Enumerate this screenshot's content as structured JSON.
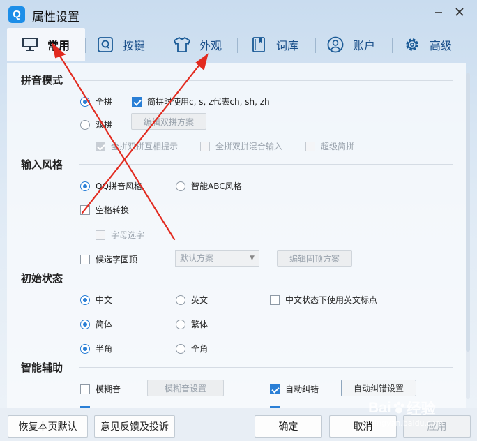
{
  "window": {
    "title": "属性设置",
    "logo_letter": "Q"
  },
  "tabs": [
    {
      "label": "常用",
      "icon": "monitor-icon",
      "active": true
    },
    {
      "label": "按键",
      "icon": "key-q-icon"
    },
    {
      "label": "外观",
      "icon": "tshirt-icon"
    },
    {
      "label": "词库",
      "icon": "book-icon"
    },
    {
      "label": "账户",
      "icon": "user-icon"
    },
    {
      "label": "高级",
      "icon": "gear-icon"
    }
  ],
  "sections": {
    "pinyin_mode": {
      "title": "拼音模式",
      "full_pinyin": "全拼",
      "simple_pinyin": "简拼时使用c, s, z代表ch, sh, zh",
      "double_pinyin": "双拼",
      "edit_double_scheme": "编辑双拼方案",
      "full_double_hint": "全拼双拼互相提示",
      "full_double_mix": "全拼双拼混合输入",
      "super_simple": "超级简拼"
    },
    "input_style": {
      "title": "输入风格",
      "qq_style": "QQ拼音风格",
      "abc_style": "智能ABC风格",
      "space_convert": "空格转换",
      "letter_select": "字母选字",
      "fixed_candidates": "候选字固顶",
      "default_scheme": "默认方案",
      "edit_fixed_scheme": "编辑固顶方案"
    },
    "initial_state": {
      "title": "初始状态",
      "chinese": "中文",
      "english": "英文",
      "en_punct": "中文状态下使用英文标点",
      "simplified": "简体",
      "traditional": "繁体",
      "half_width": "半角",
      "full_width": "全角"
    },
    "smart_assist": {
      "title": "智能辅助",
      "fuzzy": "模糊音",
      "fuzzy_settings": "模糊音设置",
      "auto_correct": "自动纠错",
      "auto_correct_settings": "自动纠错设置"
    }
  },
  "footer": {
    "restore": "恢复本页默认",
    "feedback": "意见反馈及投诉",
    "ok": "确定",
    "cancel": "取消",
    "apply": "应用"
  },
  "watermark": {
    "brand": "Bai",
    "brand_suffix": "经验",
    "url": "jingyan.baidu.com"
  },
  "colors": {
    "accent": "#2a7fd6",
    "annotation": "#e22b20"
  }
}
